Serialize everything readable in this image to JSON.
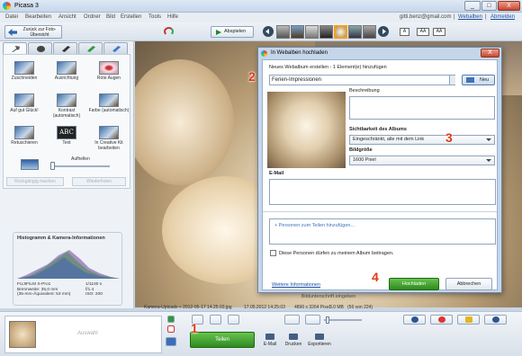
{
  "window": {
    "title": "Picasa 3",
    "min": "_",
    "max": "□",
    "close": "X"
  },
  "menu": {
    "items": [
      "Datei",
      "Bearbeiten",
      "Ansicht",
      "Ordner",
      "Bild",
      "Erstellen",
      "Tools",
      "Hilfe"
    ],
    "user": "gitti.benz@gmail.com",
    "sep": "|",
    "webalben": "Webalben",
    "abmelden": "Abmelden"
  },
  "toolbar": {
    "back_label": "Zurück zur Foto-Übersicht",
    "play_label": "Abspielen",
    "view_buttons": [
      "A",
      "AA",
      "AA"
    ]
  },
  "left_panel": {
    "tools": [
      {
        "label": "Zuschneiden"
      },
      {
        "label": "Ausrichtung"
      },
      {
        "label": "Rote Augen"
      },
      {
        "label": "Auf gut Glück!"
      },
      {
        "label": "Kontrast (automatisch)"
      },
      {
        "label": "Farbe (automatisch)"
      },
      {
        "label": "Retuschieren"
      },
      {
        "label": "Text"
      },
      {
        "label": "In Creative Kit bearbeiten"
      }
    ],
    "aufhellen": "Aufhellen",
    "undo": "Rückgängig machen",
    "redo": "Wiederholen",
    "histogram_title": "Histogramm & Kamera-Informationen",
    "exif_left": "FUJIFILM X-Pro1\nBrennweite: 35,0 mm\n(35-mm-Äquivalent: 53 mm)",
    "exif_right": "1/1100 s\nf/1.4\nISO: 200"
  },
  "photo": {
    "caption": "Bildunterschrift eingeben",
    "info": {
      "path": "Kamera-Uploads » 2012-05-17 14.25.03.jpg",
      "date": "17.05.2012 14:25:03",
      "dims": "4896 x 3264 Pixel",
      "size": "3.0 MB",
      "count": "(56 von 224)"
    }
  },
  "dialog": {
    "title": "In Webalben hochladen",
    "close": "X",
    "new_album_label": "Neues Webalbum erstellen - 1 Element(e) hinzufügen",
    "album_name": "Ferien-Impressionen",
    "new_button": "Neu",
    "description_label": "Beschreibung",
    "visibility_label": "Sichtbarkeit des Albums",
    "visibility_value": "Eingeschränkt, alle mit dem Link",
    "size_label": "Bildgröße",
    "size_value": "1600 Pixel",
    "email_label": "E-Mail",
    "add_people": "+ Personen zum Teilen hinzufügen...",
    "checkbox_label": "Diese Personen dürfen zu meinem Album beitragen.",
    "settings_link": "Weitere Informationen",
    "upload_button": "Hochladen",
    "cancel_button": "Abbrechen"
  },
  "bottom": {
    "auswahl": "Auswahl",
    "teilen": "Teilen",
    "email": "E-Mail",
    "drucken": "Drucken",
    "exportieren": "Exportieren"
  },
  "callouts": [
    "1",
    "2",
    "3",
    "4"
  ],
  "colors": {
    "accent_green": "#3a9a28",
    "callout_red": "#e03a16",
    "link_blue": "#1a4fa0"
  }
}
